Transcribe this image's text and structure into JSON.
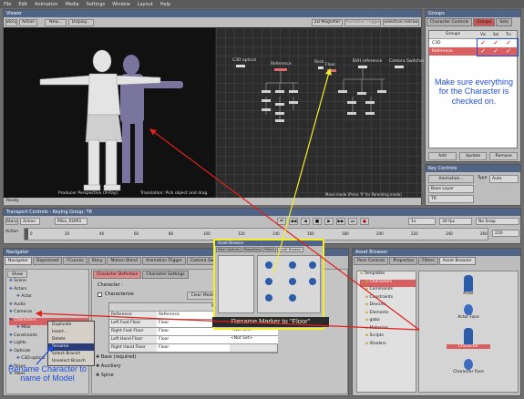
{
  "menubar": [
    "File",
    "Edit",
    "Animation",
    "Media",
    "Settings",
    "Window",
    "Layout",
    "Help"
  ],
  "viewer": {
    "title": "Viewer",
    "buttons": [
      "Story",
      "Action",
      "New...",
      "Display..."
    ],
    "right_buttons": [
      "2D Magnifier",
      "Animation Trigger",
      "Selective redraw"
    ],
    "caption_left": "Producer Perspective (X-Ray)",
    "caption_right": "Translation: Pick object and drag",
    "move_mode": "Move mode (Press 'P' for Parenting mode)",
    "status": "Ready",
    "schematic_labels": [
      "C3D optical",
      "Reference",
      "Rock",
      "Floor",
      "BVH reference",
      "Camera Switcher"
    ]
  },
  "groups": {
    "title": "Groups",
    "tabs": [
      "Character Controls",
      "Groups",
      "Sets"
    ],
    "col_header": "Groups",
    "flags": [
      "Vis",
      "Sel",
      "Trs"
    ],
    "rows": [
      "C3D",
      "Reference"
    ],
    "buttons": [
      "Add",
      "Update",
      "Remove"
    ]
  },
  "key_controls": {
    "title": "Key Controls",
    "animation": "Animation...",
    "type_label": "Type",
    "type_value": "Auto",
    "base_layer": "Base Layer",
    "tr": "TR"
  },
  "transport": {
    "title": "Transport Controls  -  Keying Group: TR",
    "story": "Story",
    "action": "Action",
    "take": "Mike_ROM3",
    "action_label": "Action",
    "fps": "30 fps",
    "snap": "No Snap",
    "speed": "1x",
    "ticks": [
      "0",
      "20",
      "40",
      "60",
      "80",
      "100",
      "120",
      "140",
      "160",
      "180",
      "200",
      "220",
      "240",
      "260"
    ],
    "frame_end": "210"
  },
  "navigator": {
    "title": "Navigator",
    "tabs": [
      "Navigator",
      "Dopesheet",
      "FCurves",
      "Story",
      "Motion Blend",
      "Animation Trigger",
      "Camera Switcher"
    ],
    "show_label": "Show",
    "tree": [
      "Scene",
      "Actors",
      "Actor",
      "Audio",
      "Cameras",
      "Characters",
      "Mike",
      "Constraints",
      "Lights",
      "Opticals",
      "C3D:optical",
      "Poses",
      "Takes"
    ],
    "inner_tabs": [
      "Character Definition",
      "Character Settings"
    ],
    "character_label": "Character :",
    "characterize": "Characterize",
    "clear_model": "Clear Model",
    "table_header": [
      "",
      "Model"
    ],
    "rows": [
      {
        "name": "Reference",
        "value": "Reference"
      },
      {
        "name": "Left Foot Floor",
        "value": "Floor"
      },
      {
        "name": "Right Foot Floor",
        "value": "Floor"
      },
      {
        "name": "Left Hand Floor",
        "value": "Floor"
      },
      {
        "name": "Right Hand Floor",
        "value": "Floor"
      }
    ],
    "extra_values": [
      "<Not Set>",
      "<Not Set>",
      "<Not Set>"
    ],
    "sections": [
      "Base (required)",
      "Auxiliary",
      "Spine"
    ]
  },
  "context_menu": [
    "Duplicate",
    "Insert...",
    "Delete",
    "Rename",
    "Select Branch",
    "Unselect Branch"
  ],
  "asset_popup": {
    "title": "Asset Browser",
    "tabs": [
      "Pose Controls",
      "Properties",
      "Filters",
      "Asset Browser"
    ]
  },
  "asset_browser": {
    "title": "Asset Browser",
    "tabs": [
      "Pose Controls",
      "Properties",
      "Filters",
      "Asset Browser"
    ],
    "tree": [
      "Templates",
      "Characters",
      "Commands",
      "Constraints",
      "Devices",
      "Elements",
      "gobo",
      "Materials",
      "Scripts",
      "Shaders"
    ],
    "items": [
      "Actor",
      "Actor Face",
      "Character",
      "Character Face"
    ]
  },
  "annotations": {
    "groups_note": "Make sure everything for the Character is checked on.",
    "rename_floor": "Rename Marker to \"Floor\"",
    "rename_character": "Rename Character to name of Model"
  },
  "colors": {
    "annotation_blue": "#1f4fd8",
    "arrow_red": "#e0201a",
    "arrow_yellow": "#f2ee2a",
    "title_blue": "#4f6486"
  }
}
